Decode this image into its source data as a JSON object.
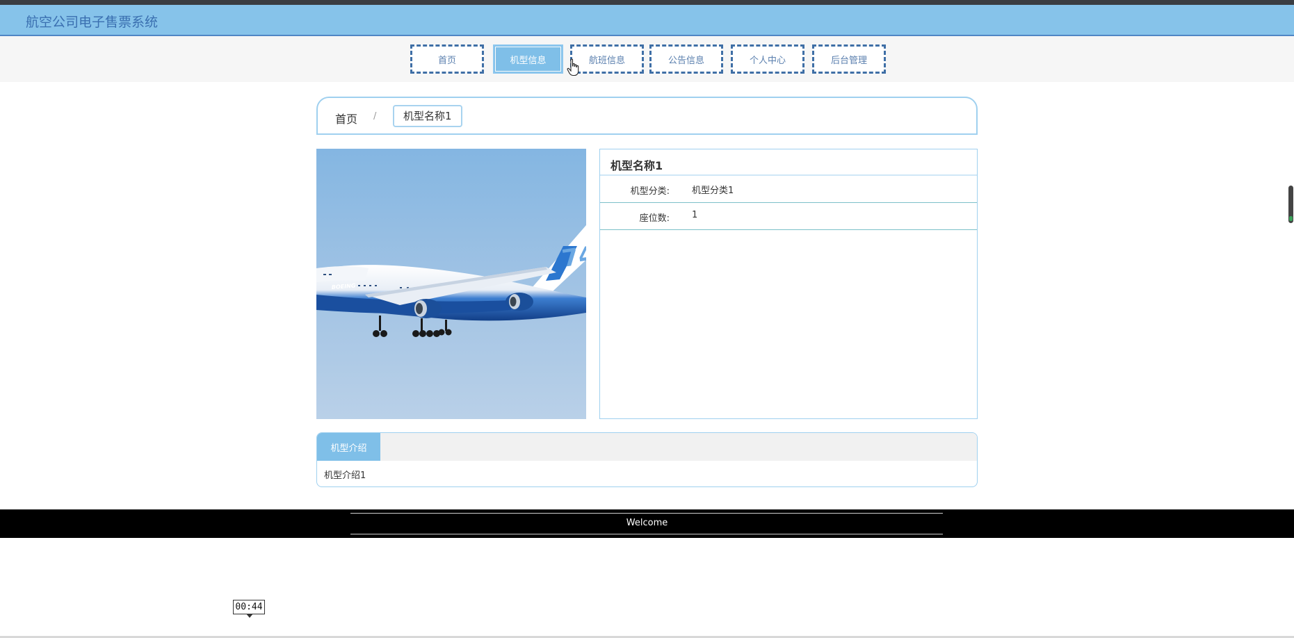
{
  "app": {
    "title": "航空公司电子售票系统"
  },
  "nav": {
    "items": [
      {
        "label": "首页",
        "active": false
      },
      {
        "label": "机型信息",
        "active": true
      },
      {
        "label": "航班信息",
        "active": false
      },
      {
        "label": "公告信息",
        "active": false
      },
      {
        "label": "个人中心",
        "active": false
      },
      {
        "label": "后台管理",
        "active": false
      }
    ]
  },
  "breadcrumb": {
    "home": "首页",
    "separator": "/",
    "current": "机型名称1"
  },
  "detail": {
    "image_alt": "airplane-photo",
    "title": "机型名称1",
    "fields": [
      {
        "label": "机型分类:",
        "value": "机型分类1"
      },
      {
        "label": "座位数:",
        "value": "1"
      }
    ]
  },
  "tabs": {
    "active_label": "机型介绍",
    "content": "机型介绍1"
  },
  "footer": {
    "text": "Welcome"
  },
  "timer": {
    "text": "00:44"
  },
  "colors": {
    "header": "#86c3ea",
    "accent": "#7fbfe8",
    "nav_border": "#3f6fa6"
  }
}
